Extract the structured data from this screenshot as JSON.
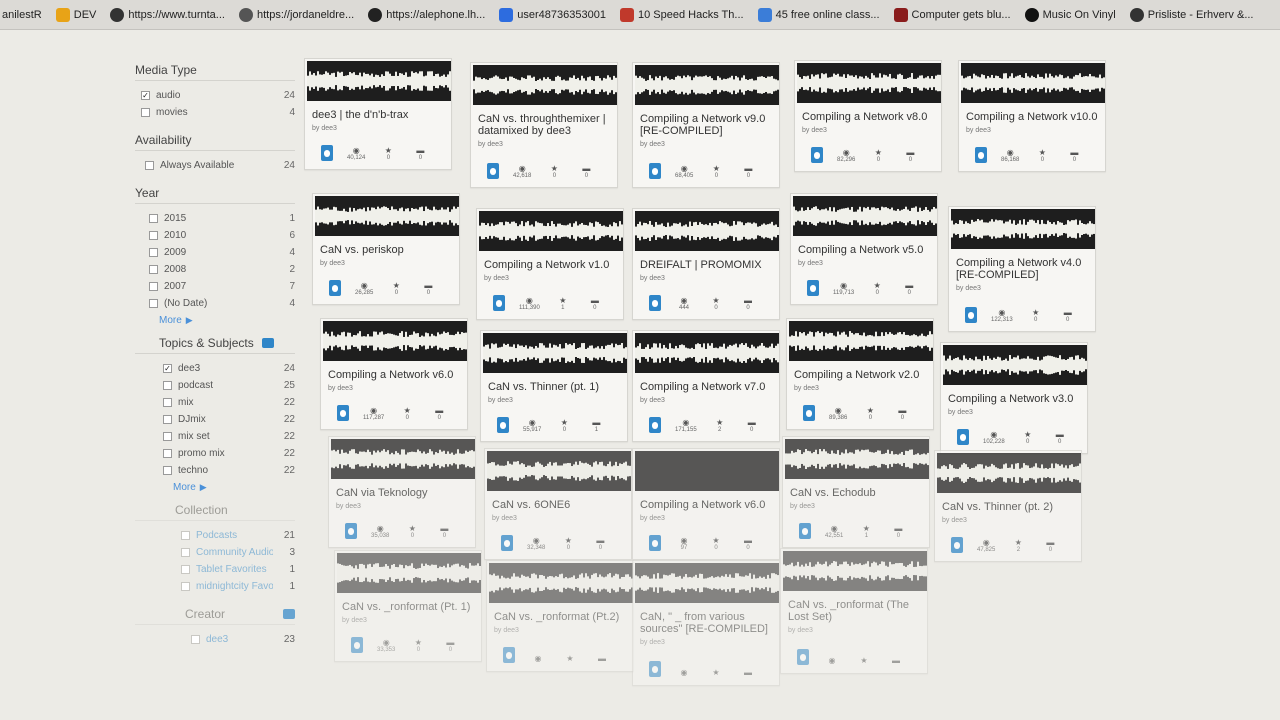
{
  "bookmarks": [
    {
      "label": "anilestR",
      "icon": "bookmark-icon",
      "color": "#7a7a7a"
    },
    {
      "label": "DEV",
      "icon": "folder-icon",
      "color": "#e8a317"
    },
    {
      "label": "https://www.turnta...",
      "icon": "turntable-icon",
      "color": "#333333"
    },
    {
      "label": "https://jordaneldre...",
      "icon": "globe-icon",
      "color": "#555555"
    },
    {
      "label": "https://alephone.lh...",
      "icon": "github-icon",
      "color": "#222222"
    },
    {
      "label": "user48736353001",
      "icon": "dropbox-icon",
      "color": "#2d6cdf"
    },
    {
      "label": "10 Speed Hacks Th...",
      "icon": "g-icon",
      "color": "#c0392b"
    },
    {
      "label": "45 free online class...",
      "icon": "page-icon",
      "color": "#3b7dd8"
    },
    {
      "label": "Computer gets blu...",
      "icon": "t-icon",
      "color": "#8a1c1c"
    },
    {
      "label": "Music On Vinyl",
      "icon": "vinyl-icon",
      "color": "#111111"
    },
    {
      "label": "Prisliste - Erhverv &...",
      "icon": "globe-icon",
      "color": "#333333"
    }
  ],
  "sidebar": {
    "media_type": {
      "heading": "Media Type",
      "items": [
        {
          "label": "audio",
          "count": "24",
          "checked": "✓"
        },
        {
          "label": "movies",
          "count": "4",
          "checked": ""
        }
      ]
    },
    "availability": {
      "heading": "Availability",
      "items": [
        {
          "label": "Always Available",
          "count": "24",
          "checked": ""
        }
      ]
    },
    "year": {
      "heading": "Year",
      "items": [
        {
          "label": "2015",
          "count": "1"
        },
        {
          "label": "2010",
          "count": "6"
        },
        {
          "label": "2009",
          "count": "4"
        },
        {
          "label": "2008",
          "count": "2"
        },
        {
          "label": "2007",
          "count": "7"
        },
        {
          "label": "(No Date)",
          "count": "4"
        }
      ],
      "more": "More"
    },
    "topics": {
      "heading": "Topics & Subjects",
      "items": [
        {
          "label": "dee3",
          "count": "24",
          "checked": "✓"
        },
        {
          "label": "podcast",
          "count": "25",
          "checked": ""
        },
        {
          "label": "mix",
          "count": "22",
          "checked": ""
        },
        {
          "label": "DJmix",
          "count": "22",
          "checked": ""
        },
        {
          "label": "mix set",
          "count": "22",
          "checked": ""
        },
        {
          "label": "promo mix",
          "count": "22",
          "checked": ""
        },
        {
          "label": "techno",
          "count": "22",
          "checked": ""
        }
      ],
      "more": "More"
    },
    "collection": {
      "heading": "Collection",
      "items": [
        {
          "label": "Podcasts",
          "count": "21"
        },
        {
          "label": "Community Audio",
          "count": "3"
        },
        {
          "label": "Tablet Favorites",
          "count": "1"
        },
        {
          "label": "midnightcity Favorites",
          "count": "1"
        }
      ]
    },
    "creator": {
      "heading": "Creator",
      "items": [
        {
          "label": "dee3",
          "count": "23"
        }
      ]
    }
  },
  "cards": [
    {
      "title": "dee3 | the d'n'b-trax",
      "by": "by dee3",
      "views": "40,124",
      "favs": "0",
      "reviews": "0"
    },
    {
      "title": "CaN vs. throughthemixer | datamixed by dee3",
      "by": "by dee3",
      "views": "42,618",
      "favs": "0",
      "reviews": "0"
    },
    {
      "title": "Compiling a Network v9.0 [RE-COMPILED]",
      "by": "by dee3",
      "views": "68,405",
      "favs": "0",
      "reviews": "0"
    },
    {
      "title": "Compiling a Network v8.0",
      "by": "by dee3",
      "views": "82,296",
      "favs": "0",
      "reviews": "0"
    },
    {
      "title": "Compiling a Network v10.0",
      "by": "by dee3",
      "views": "86,168",
      "favs": "0",
      "reviews": "0"
    },
    {
      "title": "CaN vs. periskop",
      "by": "by dee3",
      "views": "26,285",
      "favs": "0",
      "reviews": "0"
    },
    {
      "title": "Compiling a Network v1.0",
      "by": "by dee3",
      "views": "111,390",
      "favs": "1",
      "reviews": "0"
    },
    {
      "title": "DREIFALT | PROMOMIX",
      "by": "by dee3",
      "views": "444",
      "favs": "0",
      "reviews": "0"
    },
    {
      "title": "Compiling a Network v5.0",
      "by": "by dee3",
      "views": "119,713",
      "favs": "0",
      "reviews": "0"
    },
    {
      "title": "Compiling a Network v4.0 [RE-COMPILED]",
      "by": "by dee3",
      "views": "122,313",
      "favs": "0",
      "reviews": "0"
    },
    {
      "title": "Compiling a Network v6.0",
      "by": "by dee3",
      "views": "117,287",
      "favs": "0",
      "reviews": "0"
    },
    {
      "title": "CaN vs. Thinner (pt. 1)",
      "by": "by dee3",
      "views": "55,917",
      "favs": "0",
      "reviews": "1"
    },
    {
      "title": "Compiling a Network v7.0",
      "by": "by dee3",
      "views": "171,155",
      "favs": "2",
      "reviews": "0"
    },
    {
      "title": "Compiling a Network v2.0",
      "by": "by dee3",
      "views": "89,386",
      "favs": "0",
      "reviews": "0"
    },
    {
      "title": "Compiling a Network v3.0",
      "by": "by dee3",
      "views": "102,228",
      "favs": "0",
      "reviews": "0"
    },
    {
      "title": "CaN via Teknology",
      "by": "by dee3",
      "views": "35,038",
      "favs": "0",
      "reviews": "0"
    },
    {
      "title": "CaN vs. 6ONE6",
      "by": "by dee3",
      "views": "32,348",
      "favs": "0",
      "reviews": "0"
    },
    {
      "title": "Compiling a Network v6.0",
      "by": "by dee3",
      "views": "97",
      "favs": "0",
      "reviews": "0"
    },
    {
      "title": "CaN vs. Echodub",
      "by": "by dee3",
      "views": "42,551",
      "favs": "1",
      "reviews": "0"
    },
    {
      "title": "CaN vs. Thinner (pt. 2)",
      "by": "by dee3",
      "views": "47,825",
      "favs": "2",
      "reviews": "0"
    },
    {
      "title": "CaN vs. _ronformat (Pt. 1)",
      "by": "by dee3",
      "views": "33,353",
      "favs": "0",
      "reviews": "0"
    },
    {
      "title": "CaN vs. _ronformat (Pt.2)",
      "by": "by dee3",
      "views": "",
      "favs": "",
      "reviews": ""
    },
    {
      "title": "CaN, \" _ from various sources\" [RE-COMPILED]",
      "by": "by dee3",
      "views": "",
      "favs": "",
      "reviews": ""
    },
    {
      "title": "CaN vs. _ronformat (The Lost Set)",
      "by": "by dee3",
      "views": "",
      "favs": "",
      "reviews": ""
    }
  ],
  "colors": {
    "accent": "#2f86c8",
    "link": "#4a90d9",
    "waveform_bg": "#1e1e1e",
    "waveform_fg": "#f0f0ea"
  }
}
